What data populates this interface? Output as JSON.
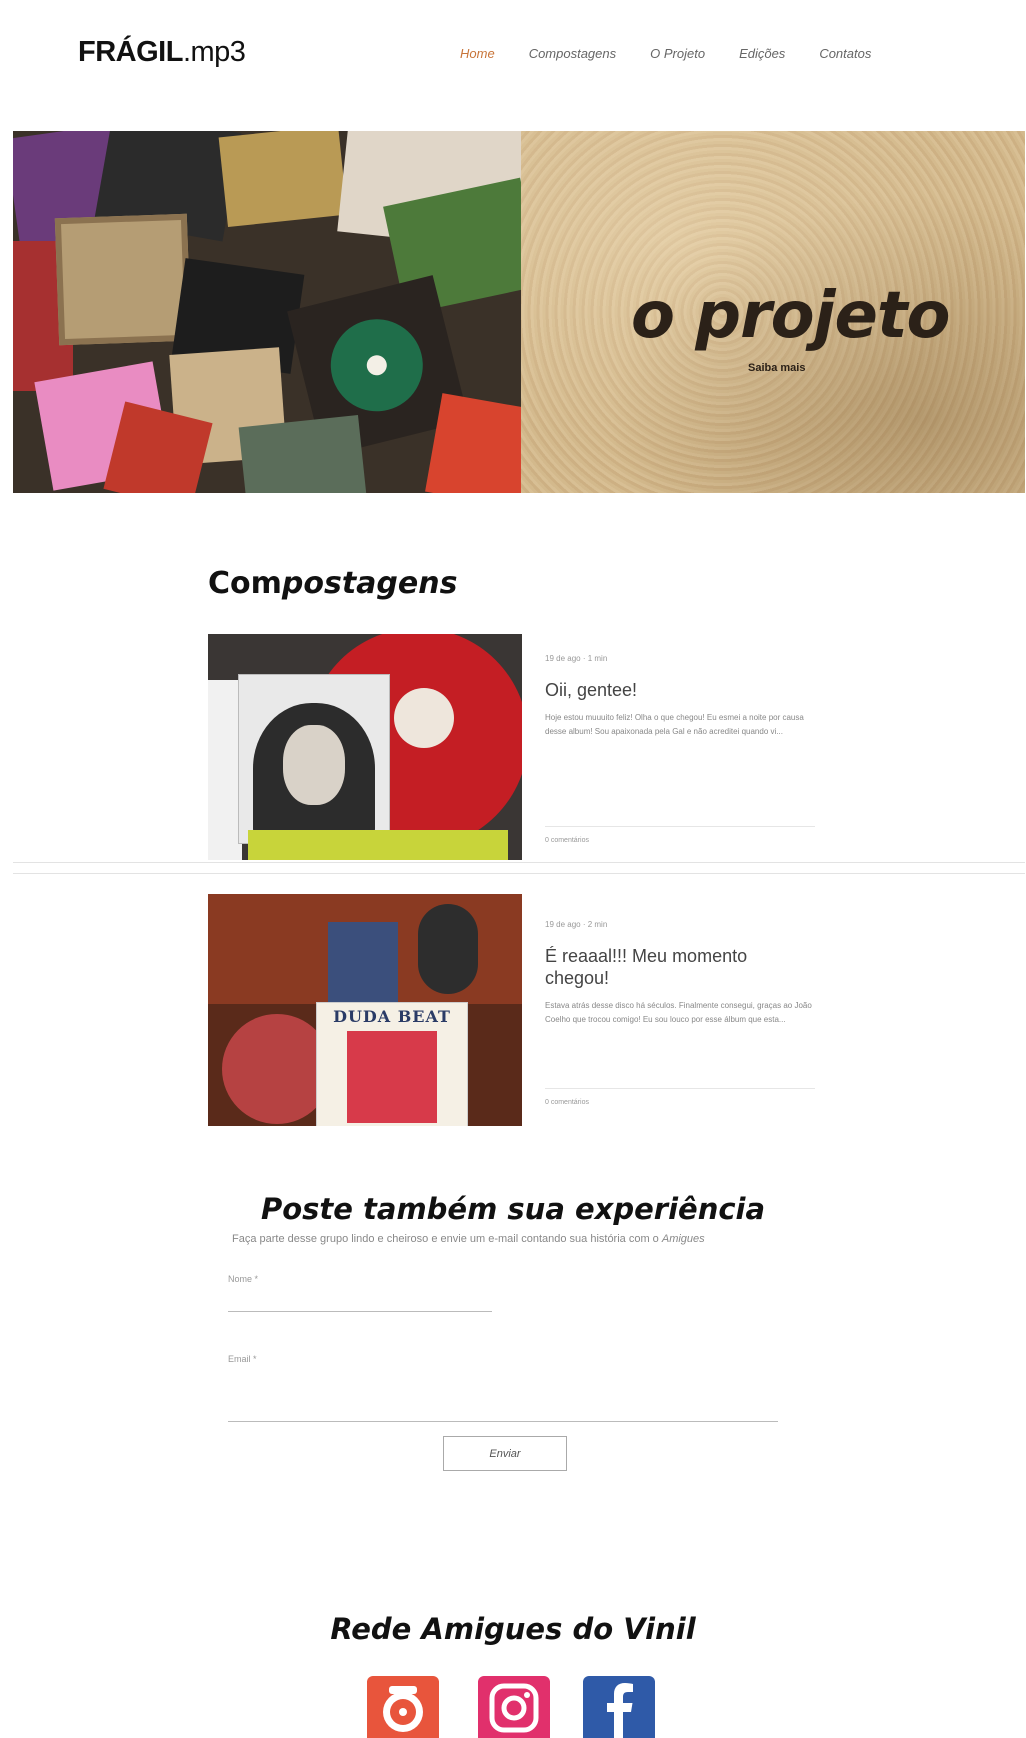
{
  "header": {
    "logo_bold": "FRÁGIL",
    "logo_rest": ".mp3",
    "nav": [
      {
        "label": "Home",
        "active": true
      },
      {
        "label": "Compostagens",
        "active": false
      },
      {
        "label": "O Projeto",
        "active": false
      },
      {
        "label": "Edições",
        "active": false
      },
      {
        "label": "Contatos",
        "active": false
      }
    ]
  },
  "hero": {
    "title": "o projeto",
    "link": "Saiba mais"
  },
  "section": {
    "title_regular": "Com",
    "title_italic": "postagens"
  },
  "posts": [
    {
      "meta": "19 de ago · 1 min",
      "title": "Oii, gentee!",
      "excerpt": "Hoje estou muuuito feliz! Olha o que chegou! Eu esmei a noite por causa desse album! Sou apaixonada pela Gal e não acreditei quando vi...",
      "comments": "0 comentários"
    },
    {
      "meta": "19 de ago · 2 min",
      "title": "É reaaal!!! Meu momento chegou!",
      "excerpt": "Estava atrás desse disco há séculos. Finalmente consegui, graças ao João Coelho que trocou comigo! Eu sou louco por esse álbum que esta...",
      "comments": "0 comentários"
    }
  ],
  "form": {
    "title": "Poste também sua experiência",
    "subtitle": "Faça parte desse grupo lindo e cheiroso e envie um e-mail contando sua história com o",
    "subtitle_italic": "Amigues",
    "name_label": "Nome *",
    "email_label": "Email *",
    "submit": "Enviar"
  },
  "network": {
    "title": "Rede Amigues do Vinil",
    "icons": [
      "amigues-logo-icon",
      "instagram-icon",
      "facebook-icon"
    ],
    "colors": {
      "amigues": "#e8553c",
      "instagram": "#e1306c",
      "facebook": "#2f5aa8"
    }
  },
  "colors": {
    "accent": "#c8753a",
    "background": "#ffffff"
  }
}
